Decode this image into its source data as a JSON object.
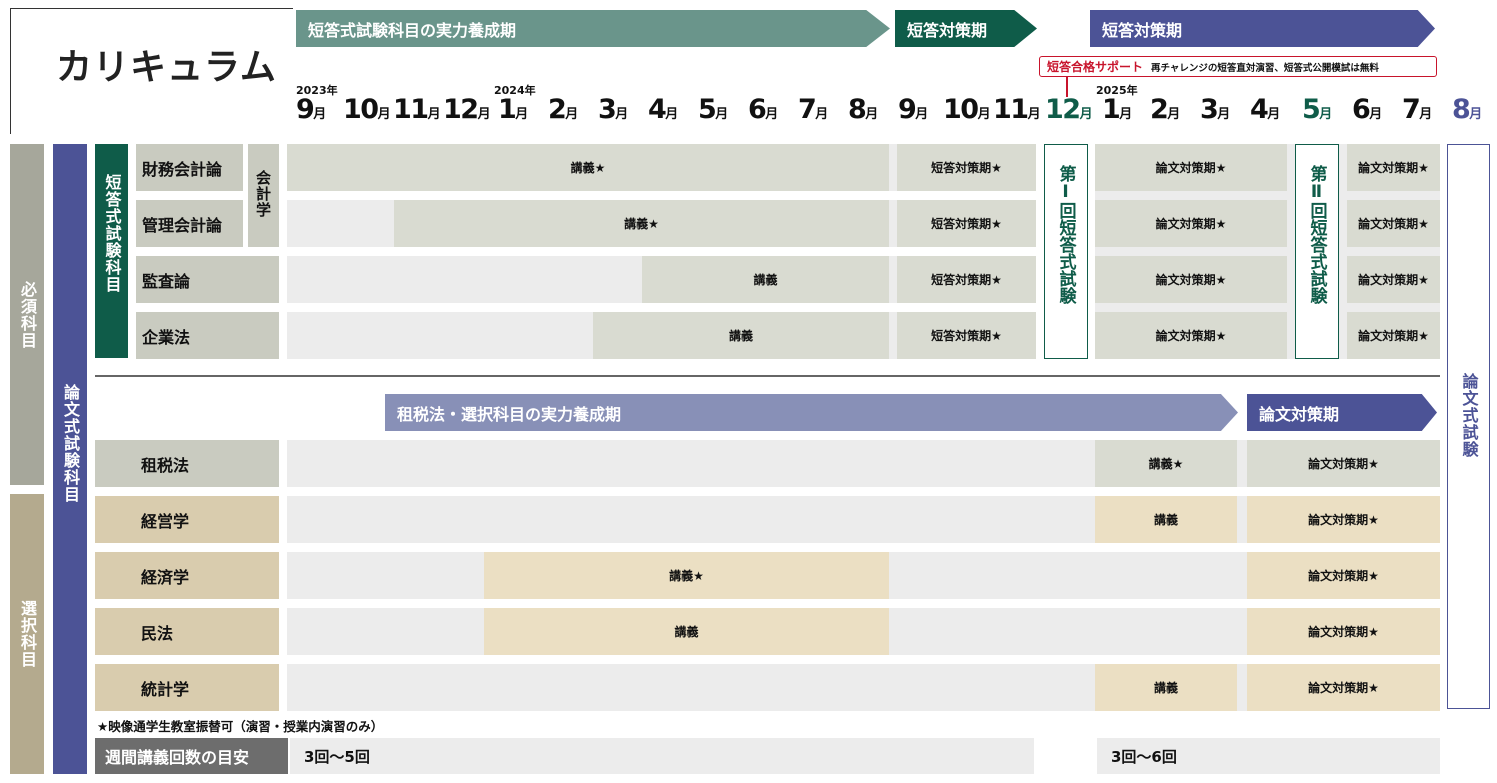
{
  "title": "カリキュラム",
  "phases": {
    "p1": "短答式試験科目の実力養成期",
    "p2": "短答対策期",
    "p3": "短答対策期",
    "p4": "租税法・選択科目の実力養成期",
    "p5": "論文対策期"
  },
  "support": {
    "label": "短答合格サポート",
    "text": "再チャレンジの短答直対演習、短答式公開模試は無料"
  },
  "years": {
    "y2023": "2023年",
    "y2024": "2024年",
    "y2025": "2025年"
  },
  "months": [
    {
      "n": "9",
      "u": "月"
    },
    {
      "n": "10",
      "u": "月"
    },
    {
      "n": "11",
      "u": "月"
    },
    {
      "n": "12",
      "u": "月"
    },
    {
      "n": "1",
      "u": "月"
    },
    {
      "n": "2",
      "u": "月"
    },
    {
      "n": "3",
      "u": "月"
    },
    {
      "n": "4",
      "u": "月"
    },
    {
      "n": "5",
      "u": "月"
    },
    {
      "n": "6",
      "u": "月"
    },
    {
      "n": "7",
      "u": "月"
    },
    {
      "n": "8",
      "u": "月"
    },
    {
      "n": "9",
      "u": "月"
    },
    {
      "n": "10",
      "u": "月"
    },
    {
      "n": "11",
      "u": "月"
    },
    {
      "n": "12",
      "u": "月"
    },
    {
      "n": "1",
      "u": "月"
    },
    {
      "n": "2",
      "u": "月"
    },
    {
      "n": "3",
      "u": "月"
    },
    {
      "n": "4",
      "u": "月"
    },
    {
      "n": "5",
      "u": "月"
    },
    {
      "n": "6",
      "u": "月"
    },
    {
      "n": "7",
      "u": "月"
    },
    {
      "n": "8",
      "u": "月"
    }
  ],
  "left": {
    "required": "必須科目",
    "elective": "選択科目",
    "essay_subjects": "論文式試験科目",
    "short_subjects": "短答式試験科目",
    "accounting": "会計学"
  },
  "subjects": {
    "s1": "財務会計論",
    "s2": "管理会計論",
    "s3": "監査論",
    "s4": "企業法",
    "e1": "租税法",
    "e2": "経営学",
    "e3": "経済学",
    "e4": "民法",
    "e5": "統計学"
  },
  "cells": {
    "lecture_star": "講義★",
    "lecture": "講義",
    "short_star": "短答対策期★",
    "essay_star": "論文対策期★"
  },
  "exams": {
    "exam1": "第Ⅰ回短答式試験",
    "exam2": "第Ⅱ回短答式試験",
    "essay_exam": "論文式試験"
  },
  "footnote": "★映像通学生教室振替可（演習・授業内演習のみ）",
  "weekly": {
    "label": "週間講義回数の目安",
    "v1": "3回〜5回",
    "v2": "3回〜6回"
  },
  "colors": {
    "green_arrow": "#6a958b",
    "dark_green": "#0f5c49",
    "navy": "#4c5396",
    "light_navy": "#8890b7",
    "gray_label": "#c9cbc0",
    "gray_cell": "#d9dbd1",
    "tan_label": "#d9ccae",
    "tan_cell": "#ebdfc3",
    "support_red": "#c8142c"
  }
}
